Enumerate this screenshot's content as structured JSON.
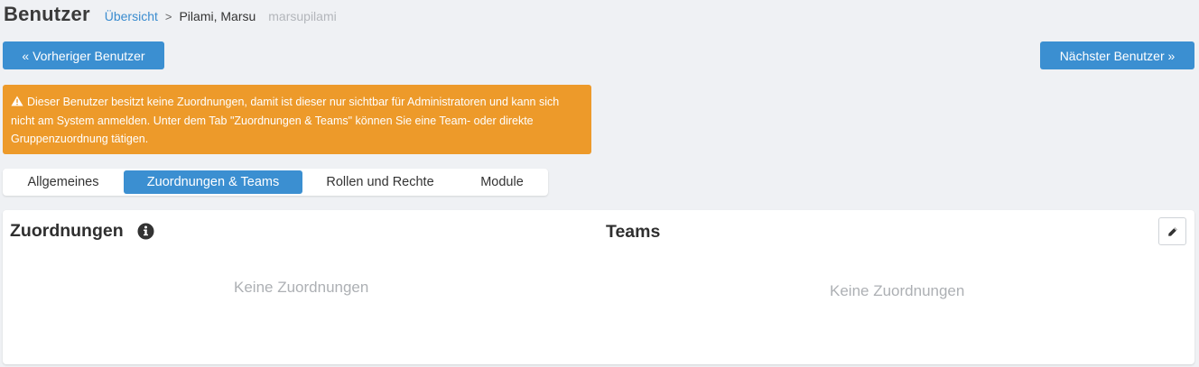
{
  "header": {
    "title": "Benutzer",
    "breadcrumb": {
      "overview": "Übersicht",
      "separator": ">",
      "current": "Pilami, Marsu",
      "login": "marsupilami"
    }
  },
  "nav": {
    "prev_label": "« Vorheriger Benutzer",
    "next_label": "Nächster Benutzer »"
  },
  "alert": {
    "icon": "warning-icon",
    "text": "Dieser Benutzer besitzt keine Zuordnungen, damit ist dieser nur sichtbar für Administratoren und kann sich nicht am System anmelden. Unter dem Tab \"Zuordnungen & Teams\" können Sie eine Team- oder direkte Gruppenzuordnung tätigen.",
    "color": "#ed9a2a"
  },
  "tabs": [
    {
      "label": "Allgemeines",
      "active": false
    },
    {
      "label": "Zuordnungen & Teams",
      "active": true
    },
    {
      "label": "Rollen und Rechte",
      "active": false
    },
    {
      "label": "Module",
      "active": false
    }
  ],
  "panel": {
    "assignments": {
      "title": "Zuordnungen",
      "info_icon": "info-circle-icon",
      "empty_text": "Keine Zuordnungen"
    },
    "teams": {
      "title": "Teams",
      "edit_icon": "pencil-icon",
      "empty_text": "Keine Zuordnungen"
    }
  },
  "colors": {
    "accent": "#3b8fd1",
    "link": "#3a8ccf",
    "background": "#eff1f4"
  }
}
